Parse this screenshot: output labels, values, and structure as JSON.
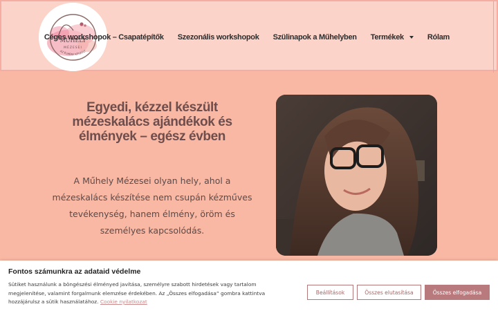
{
  "header": {
    "logo_text_main": "MŰHELY",
    "logo_text_sub": "MÉZESEI",
    "logo_ring_text": "AZ ÉLMÉNY KÉSZÜLT",
    "nav": [
      {
        "label": "Céges workshopok – Csapatépítők"
      },
      {
        "label": "Szezonális workshopok"
      },
      {
        "label": "Szülinapok a Műhelyben"
      },
      {
        "label": "Termékek",
        "has_dropdown": true
      },
      {
        "label": "Rólam"
      }
    ]
  },
  "hero": {
    "title": "Egyedi, kézzel készült mézeskalács ajándékok és élmények – egész évben",
    "text": "A Műhely Mézesei olyan hely, ahol a mézeskalács készítése nem csupán kézműves tevékenység, hanem élmény, öröm és személyes kapcsolódás."
  },
  "cookie": {
    "title": "Fontos számunkra az adataid védelme",
    "text": "Sütiket használunk a böngészési élményed javítása, személyre szabott hirdetések vagy tartalom megjelenítése, valamint forgalmunk elemzése érdekében. Az „Összes elfogadása” gombra kattintva hozzájárulsz a sütik használatához.",
    "link": "Cookie nyilatkozat",
    "buttons": {
      "settings": "Beállítások",
      "reject": "Összes elutasítása",
      "accept": "Összes elfogadása"
    }
  },
  "colors": {
    "page_bg": "#f9b8a3",
    "header_bg": "#fcd3c9",
    "title_color": "#6e4d4d",
    "accept_button": "#b97a7e"
  }
}
